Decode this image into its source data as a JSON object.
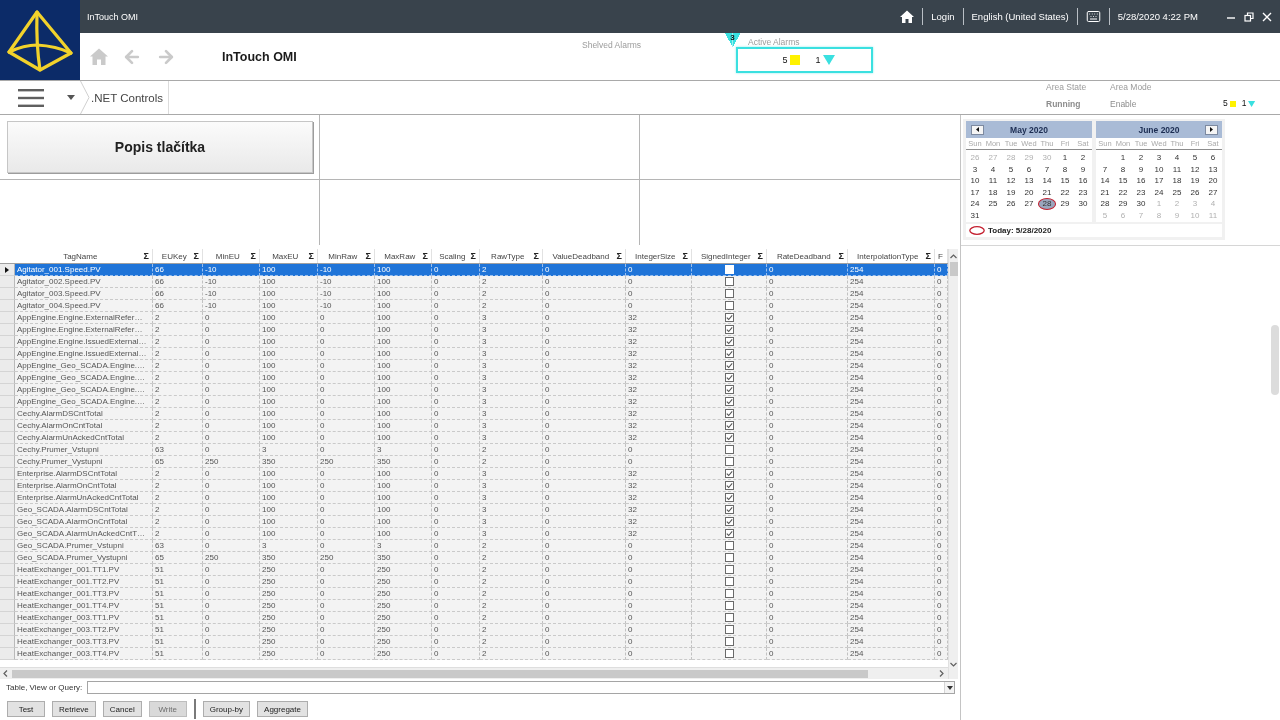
{
  "title_bar": {
    "title": "InTouch OMI",
    "login": "Login",
    "language": "English (United States)",
    "datetime": "5/28/2020 4:22 PM"
  },
  "nav": {
    "title": "InTouch OMI",
    "shelved_alarms": "Shelved Alarms",
    "active_alarms": {
      "label": "Active Alarms",
      "badge": "3",
      "counts": [
        {
          "value": "5",
          "kind": "square",
          "color": "#fff200"
        },
        {
          "value": "1",
          "kind": "triangle",
          "color": "#3ae0e0"
        }
      ]
    }
  },
  "breadcrumb": {
    "items": [
      ".NET Controls"
    ]
  },
  "area": {
    "state_label": "Area State",
    "state": "Running",
    "mode_label": "Area Mode",
    "mode": "Enable",
    "counts": [
      {
        "value": "5",
        "kind": "square",
        "color": "#fff200"
      },
      {
        "value": "1",
        "kind": "triangle",
        "color": "#3ae0e0"
      }
    ]
  },
  "panel": {
    "button": "Popis tlačítka"
  },
  "calendar": {
    "months": [
      {
        "title": "May 2020",
        "prev_button": true,
        "next_button": false,
        "weekdays": [
          "Sun",
          "Mon",
          "Tue",
          "Wed",
          "Thu",
          "Fri",
          "Sat"
        ],
        "weeks": [
          [
            {
              "day": "26",
              "muted": true,
              "today": false
            },
            {
              "day": "27",
              "muted": true,
              "today": false
            },
            {
              "day": "28",
              "muted": true,
              "today": false
            },
            {
              "day": "29",
              "muted": true,
              "today": false
            },
            {
              "day": "30",
              "muted": true,
              "today": false
            },
            {
              "day": "1",
              "muted": false,
              "today": false
            },
            {
              "day": "2",
              "muted": false,
              "today": false
            }
          ],
          [
            {
              "day": "3",
              "muted": false,
              "today": false
            },
            {
              "day": "4",
              "muted": false,
              "today": false
            },
            {
              "day": "5",
              "muted": false,
              "today": false
            },
            {
              "day": "6",
              "muted": false,
              "today": false
            },
            {
              "day": "7",
              "muted": false,
              "today": false
            },
            {
              "day": "8",
              "muted": false,
              "today": false
            },
            {
              "day": "9",
              "muted": false,
              "today": false
            }
          ],
          [
            {
              "day": "10",
              "muted": false,
              "today": false
            },
            {
              "day": "11",
              "muted": false,
              "today": false
            },
            {
              "day": "12",
              "muted": false,
              "today": false
            },
            {
              "day": "13",
              "muted": false,
              "today": false
            },
            {
              "day": "14",
              "muted": false,
              "today": false
            },
            {
              "day": "15",
              "muted": false,
              "today": false
            },
            {
              "day": "16",
              "muted": false,
              "today": false
            }
          ],
          [
            {
              "day": "17",
              "muted": false,
              "today": false
            },
            {
              "day": "18",
              "muted": false,
              "today": false
            },
            {
              "day": "19",
              "muted": false,
              "today": false
            },
            {
              "day": "20",
              "muted": false,
              "today": false
            },
            {
              "day": "21",
              "muted": false,
              "today": false
            },
            {
              "day": "22",
              "muted": false,
              "today": false
            },
            {
              "day": "23",
              "muted": false,
              "today": false
            }
          ],
          [
            {
              "day": "24",
              "muted": false,
              "today": false
            },
            {
              "day": "25",
              "muted": false,
              "today": false
            },
            {
              "day": "26",
              "muted": false,
              "today": false
            },
            {
              "day": "27",
              "muted": false,
              "today": false
            },
            {
              "day": "28",
              "muted": false,
              "today": true
            },
            {
              "day": "29",
              "muted": false,
              "today": false
            },
            {
              "day": "30",
              "muted": false,
              "today": false
            }
          ],
          [
            {
              "day": "31",
              "muted": false,
              "today": false
            }
          ]
        ]
      },
      {
        "title": "June 2020",
        "prev_button": false,
        "next_button": true,
        "weekdays": [
          "Sun",
          "Mon",
          "Tue",
          "Wed",
          "Thu",
          "Fri",
          "Sat"
        ],
        "weeks": [
          [
            {
              "day": "1",
              "muted": false,
              "today": false
            },
            {
              "day": "2",
              "muted": false,
              "today": false
            },
            {
              "day": "3",
              "muted": false,
              "today": false
            },
            {
              "day": "4",
              "muted": false,
              "today": false
            },
            {
              "day": "5",
              "muted": false,
              "today": false
            },
            {
              "day": "6",
              "muted": false,
              "today": false
            }
          ],
          [
            {
              "day": "7",
              "muted": false,
              "today": false
            },
            {
              "day": "8",
              "muted": false,
              "today": false
            },
            {
              "day": "9",
              "muted": false,
              "today": false
            },
            {
              "day": "10",
              "muted": false,
              "today": false
            },
            {
              "day": "11",
              "muted": false,
              "today": false
            },
            {
              "day": "12",
              "muted": false,
              "today": false
            },
            {
              "day": "13",
              "muted": false,
              "today": false
            }
          ],
          [
            {
              "day": "14",
              "muted": false,
              "today": false
            },
            {
              "day": "15",
              "muted": false,
              "today": false
            },
            {
              "day": "16",
              "muted": false,
              "today": false
            },
            {
              "day": "17",
              "muted": false,
              "today": false
            },
            {
              "day": "18",
              "muted": false,
              "today": false
            },
            {
              "day": "19",
              "muted": false,
              "today": false
            },
            {
              "day": "20",
              "muted": false,
              "today": false
            }
          ],
          [
            {
              "day": "21",
              "muted": false,
              "today": false
            },
            {
              "day": "22",
              "muted": false,
              "today": false
            },
            {
              "day": "23",
              "muted": false,
              "today": false
            },
            {
              "day": "24",
              "muted": false,
              "today": false
            },
            {
              "day": "25",
              "muted": false,
              "today": false
            },
            {
              "day": "26",
              "muted": false,
              "today": false
            },
            {
              "day": "27",
              "muted": false,
              "today": false
            }
          ],
          [
            {
              "day": "28",
              "muted": false,
              "today": false
            },
            {
              "day": "29",
              "muted": false,
              "today": false
            },
            {
              "day": "30",
              "muted": false,
              "today": false
            },
            {
              "day": "1",
              "muted": true,
              "today": false
            },
            {
              "day": "2",
              "muted": true,
              "today": false
            },
            {
              "day": "3",
              "muted": true,
              "today": false
            },
            {
              "day": "4",
              "muted": true,
              "today": false
            }
          ],
          [
            {
              "day": "5",
              "muted": true,
              "today": false
            },
            {
              "day": "6",
              "muted": true,
              "today": false
            },
            {
              "day": "7",
              "muted": true,
              "today": false
            },
            {
              "day": "8",
              "muted": true,
              "today": false
            },
            {
              "day": "9",
              "muted": true,
              "today": false
            },
            {
              "day": "10",
              "muted": true,
              "today": false
            },
            {
              "day": "11",
              "muted": true,
              "today": false
            }
          ]
        ]
      }
    ],
    "today": "Today: 5/28/2020"
  },
  "table": {
    "columns": [
      {
        "label": "TagName",
        "kind": "text",
        "sum": "Σ"
      },
      {
        "label": "EUKey",
        "kind": "text",
        "sum": "Σ"
      },
      {
        "label": "MinEU",
        "kind": "text",
        "sum": "Σ"
      },
      {
        "label": "MaxEU",
        "kind": "text",
        "sum": "Σ"
      },
      {
        "label": "MinRaw",
        "kind": "text",
        "sum": "Σ"
      },
      {
        "label": "MaxRaw",
        "kind": "text",
        "sum": "Σ"
      },
      {
        "label": "Scaling",
        "kind": "text",
        "sum": "Σ"
      },
      {
        "label": "RawType",
        "kind": "text",
        "sum": "Σ"
      },
      {
        "label": "ValueDeadband",
        "kind": "text",
        "sum": "Σ"
      },
      {
        "label": "IntegerSize",
        "kind": "text",
        "sum": "Σ"
      },
      {
        "label": "SignedInteger",
        "kind": "check",
        "sum": "Σ"
      },
      {
        "label": "RateDeadband",
        "kind": "text",
        "sum": "Σ"
      },
      {
        "label": "InterpolationType",
        "kind": "text",
        "sum": "Σ"
      },
      {
        "label": "F",
        "kind": "text"
      }
    ],
    "rows": [
      {
        "selected": true,
        "checked": false,
        "cells": [
          "Agitator_001.Speed.PV",
          "66",
          "-10",
          "100",
          "-10",
          "100",
          "0",
          "2",
          "0",
          "0",
          "0",
          "254",
          "0"
        ]
      },
      {
        "selected": false,
        "checked": false,
        "cells": [
          "Agitator_002.Speed.PV",
          "66",
          "-10",
          "100",
          "-10",
          "100",
          "0",
          "2",
          "0",
          "0",
          "0",
          "254",
          "0"
        ]
      },
      {
        "selected": false,
        "checked": false,
        "cells": [
          "Agitator_003.Speed.PV",
          "66",
          "-10",
          "100",
          "-10",
          "100",
          "0",
          "2",
          "0",
          "0",
          "0",
          "254",
          "0"
        ]
      },
      {
        "selected": false,
        "checked": false,
        "cells": [
          "Agitator_004.Speed.PV",
          "66",
          "-10",
          "100",
          "-10",
          "100",
          "0",
          "2",
          "0",
          "0",
          "0",
          "254",
          "0"
        ]
      },
      {
        "selected": false,
        "checked": true,
        "cells": [
          "AppEngine.Engine.ExternalRefer…",
          "2",
          "0",
          "100",
          "0",
          "100",
          "0",
          "3",
          "0",
          "32",
          "0",
          "254",
          "0"
        ]
      },
      {
        "selected": false,
        "checked": true,
        "cells": [
          "AppEngine.Engine.ExternalRefer…",
          "2",
          "0",
          "100",
          "0",
          "100",
          "0",
          "3",
          "0",
          "32",
          "0",
          "254",
          "0"
        ]
      },
      {
        "selected": false,
        "checked": true,
        "cells": [
          "AppEngine.Engine.IssuedExternal…",
          "2",
          "0",
          "100",
          "0",
          "100",
          "0",
          "3",
          "0",
          "32",
          "0",
          "254",
          "0"
        ]
      },
      {
        "selected": false,
        "checked": true,
        "cells": [
          "AppEngine.Engine.IssuedExternal…",
          "2",
          "0",
          "100",
          "0",
          "100",
          "0",
          "3",
          "0",
          "32",
          "0",
          "254",
          "0"
        ]
      },
      {
        "selected": false,
        "checked": true,
        "cells": [
          "AppEngine_Geo_SCADA.Engine.…",
          "2",
          "0",
          "100",
          "0",
          "100",
          "0",
          "3",
          "0",
          "32",
          "0",
          "254",
          "0"
        ]
      },
      {
        "selected": false,
        "checked": true,
        "cells": [
          "AppEngine_Geo_SCADA.Engine.…",
          "2",
          "0",
          "100",
          "0",
          "100",
          "0",
          "3",
          "0",
          "32",
          "0",
          "254",
          "0"
        ]
      },
      {
        "selected": false,
        "checked": true,
        "cells": [
          "AppEngine_Geo_SCADA.Engine.…",
          "2",
          "0",
          "100",
          "0",
          "100",
          "0",
          "3",
          "0",
          "32",
          "0",
          "254",
          "0"
        ]
      },
      {
        "selected": false,
        "checked": true,
        "cells": [
          "AppEngine_Geo_SCADA.Engine.…",
          "2",
          "0",
          "100",
          "0",
          "100",
          "0",
          "3",
          "0",
          "32",
          "0",
          "254",
          "0"
        ]
      },
      {
        "selected": false,
        "checked": true,
        "cells": [
          "Cechy.AlarmDSCntTotal",
          "2",
          "0",
          "100",
          "0",
          "100",
          "0",
          "3",
          "0",
          "32",
          "0",
          "254",
          "0"
        ]
      },
      {
        "selected": false,
        "checked": true,
        "cells": [
          "Cechy.AlarmOnCntTotal",
          "2",
          "0",
          "100",
          "0",
          "100",
          "0",
          "3",
          "0",
          "32",
          "0",
          "254",
          "0"
        ]
      },
      {
        "selected": false,
        "checked": true,
        "cells": [
          "Cechy.AlarmUnAckedCntTotal",
          "2",
          "0",
          "100",
          "0",
          "100",
          "0",
          "3",
          "0",
          "32",
          "0",
          "254",
          "0"
        ]
      },
      {
        "selected": false,
        "checked": false,
        "cells": [
          "Cechy.Prumer_Vstupni",
          "63",
          "0",
          "3",
          "0",
          "3",
          "0",
          "2",
          "0",
          "0",
          "0",
          "254",
          "0"
        ]
      },
      {
        "selected": false,
        "checked": false,
        "cells": [
          "Cechy.Prumer_Vystupni",
          "65",
          "250",
          "350",
          "250",
          "350",
          "0",
          "2",
          "0",
          "0",
          "0",
          "254",
          "0"
        ]
      },
      {
        "selected": false,
        "checked": true,
        "cells": [
          "Enterprise.AlarmDSCntTotal",
          "2",
          "0",
          "100",
          "0",
          "100",
          "0",
          "3",
          "0",
          "32",
          "0",
          "254",
          "0"
        ]
      },
      {
        "selected": false,
        "checked": true,
        "cells": [
          "Enterprise.AlarmOnCntTotal",
          "2",
          "0",
          "100",
          "0",
          "100",
          "0",
          "3",
          "0",
          "32",
          "0",
          "254",
          "0"
        ]
      },
      {
        "selected": false,
        "checked": true,
        "cells": [
          "Enterprise.AlarmUnAckedCntTotal",
          "2",
          "0",
          "100",
          "0",
          "100",
          "0",
          "3",
          "0",
          "32",
          "0",
          "254",
          "0"
        ]
      },
      {
        "selected": false,
        "checked": true,
        "cells": [
          "Geo_SCADA.AlarmDSCntTotal",
          "2",
          "0",
          "100",
          "0",
          "100",
          "0",
          "3",
          "0",
          "32",
          "0",
          "254",
          "0"
        ]
      },
      {
        "selected": false,
        "checked": true,
        "cells": [
          "Geo_SCADA.AlarmOnCntTotal",
          "2",
          "0",
          "100",
          "0",
          "100",
          "0",
          "3",
          "0",
          "32",
          "0",
          "254",
          "0"
        ]
      },
      {
        "selected": false,
        "checked": true,
        "cells": [
          "Geo_SCADA.AlarmUnAckedCntT…",
          "2",
          "0",
          "100",
          "0",
          "100",
          "0",
          "3",
          "0",
          "32",
          "0",
          "254",
          "0"
        ]
      },
      {
        "selected": false,
        "checked": false,
        "cells": [
          "Geo_SCADA.Prumer_Vstupni",
          "63",
          "0",
          "3",
          "0",
          "3",
          "0",
          "2",
          "0",
          "0",
          "0",
          "254",
          "0"
        ]
      },
      {
        "selected": false,
        "checked": false,
        "cells": [
          "Geo_SCADA.Prumer_Vystupni",
          "65",
          "250",
          "350",
          "250",
          "350",
          "0",
          "2",
          "0",
          "0",
          "0",
          "254",
          "0"
        ]
      },
      {
        "selected": false,
        "checked": false,
        "cells": [
          "HeatExchanger_001.TT1.PV",
          "51",
          "0",
          "250",
          "0",
          "250",
          "0",
          "2",
          "0",
          "0",
          "0",
          "254",
          "0"
        ]
      },
      {
        "selected": false,
        "checked": false,
        "cells": [
          "HeatExchanger_001.TT2.PV",
          "51",
          "0",
          "250",
          "0",
          "250",
          "0",
          "2",
          "0",
          "0",
          "0",
          "254",
          "0"
        ]
      },
      {
        "selected": false,
        "checked": false,
        "cells": [
          "HeatExchanger_001.TT3.PV",
          "51",
          "0",
          "250",
          "0",
          "250",
          "0",
          "2",
          "0",
          "0",
          "0",
          "254",
          "0"
        ]
      },
      {
        "selected": false,
        "checked": false,
        "cells": [
          "HeatExchanger_001.TT4.PV",
          "51",
          "0",
          "250",
          "0",
          "250",
          "0",
          "2",
          "0",
          "0",
          "0",
          "254",
          "0"
        ]
      },
      {
        "selected": false,
        "checked": false,
        "cells": [
          "HeatExchanger_003.TT1.PV",
          "51",
          "0",
          "250",
          "0",
          "250",
          "0",
          "2",
          "0",
          "0",
          "0",
          "254",
          "0"
        ]
      },
      {
        "selected": false,
        "checked": false,
        "cells": [
          "HeatExchanger_003.TT2.PV",
          "51",
          "0",
          "250",
          "0",
          "250",
          "0",
          "2",
          "0",
          "0",
          "0",
          "254",
          "0"
        ]
      },
      {
        "selected": false,
        "checked": false,
        "cells": [
          "HeatExchanger_003.TT3.PV",
          "51",
          "0",
          "250",
          "0",
          "250",
          "0",
          "2",
          "0",
          "0",
          "0",
          "254",
          "0"
        ]
      },
      {
        "selected": false,
        "checked": false,
        "cells": [
          "HeatExchanger_003.TT4.PV",
          "51",
          "0",
          "250",
          "0",
          "250",
          "0",
          "2",
          "0",
          "0",
          "0",
          "254",
          "0"
        ]
      }
    ]
  },
  "query": {
    "label": "Table, View or Query:"
  },
  "button_groups": [
    [
      {
        "label": "Test",
        "disabled": false
      },
      {
        "label": "Retrieve",
        "disabled": false
      },
      {
        "label": "Cancel",
        "disabled": false
      },
      {
        "label": "Write",
        "disabled": true
      }
    ],
    [
      {
        "label": "Group-by",
        "disabled": false
      },
      {
        "label": "Aggregate",
        "disabled": false
      }
    ]
  ]
}
